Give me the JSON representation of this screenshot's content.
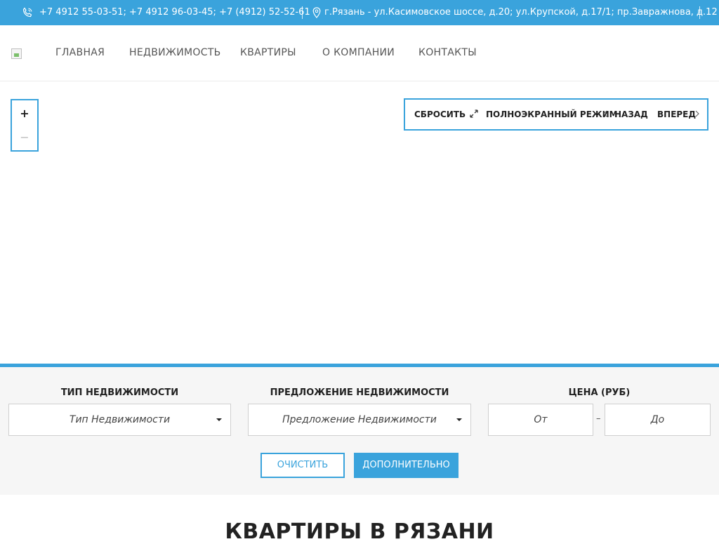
{
  "topbar": {
    "phones": "+7 4912 55-03-51; +7 4912 96-03-45; +7 (4912) 52-52-61",
    "address": "г.Рязань - ул.Касимовское шоссе, д.20; ул.Крупской, д.17/1; пр.Завражнова, д.12",
    "phone_icon": "phone-icon",
    "pin_icon": "map-pin-icon"
  },
  "nav": {
    "items": [
      "ГЛАВНАЯ",
      "НЕДВИЖИМОСТЬ",
      "КВАРТИРЫ",
      "О КОМПАНИИ",
      "КОНТАКТЫ"
    ]
  },
  "map": {
    "zoom_in": "+",
    "zoom_out": "−",
    "reset": "СБРОСИТЬ",
    "fullscreen": "ПОЛНОЭКРАННЫЙ РЕЖИМ",
    "back": "НАЗАД",
    "forward": "ВПЕРЕД"
  },
  "filter": {
    "type_label": "ТИП НЕДВИЖИМОСТИ",
    "type_value": "Тип Недвижимости",
    "offer_label": "ПРЕДЛОЖЕНИЕ НЕДВИЖИМОСТИ",
    "offer_value": "Предложение Недвижимости",
    "price_label": "ЦЕНА (РУБ)",
    "price_from": "От",
    "price_to": "До",
    "dash": "–",
    "clear_button": "ОЧИСТИТЬ",
    "more_button": "ДОПОЛНИТЕЛЬНО"
  },
  "section_heading": "КВАРТИРЫ В РЯЗАНИ",
  "colors": {
    "accent": "#3aa3dc",
    "filter_bg": "#f6f6f6"
  }
}
